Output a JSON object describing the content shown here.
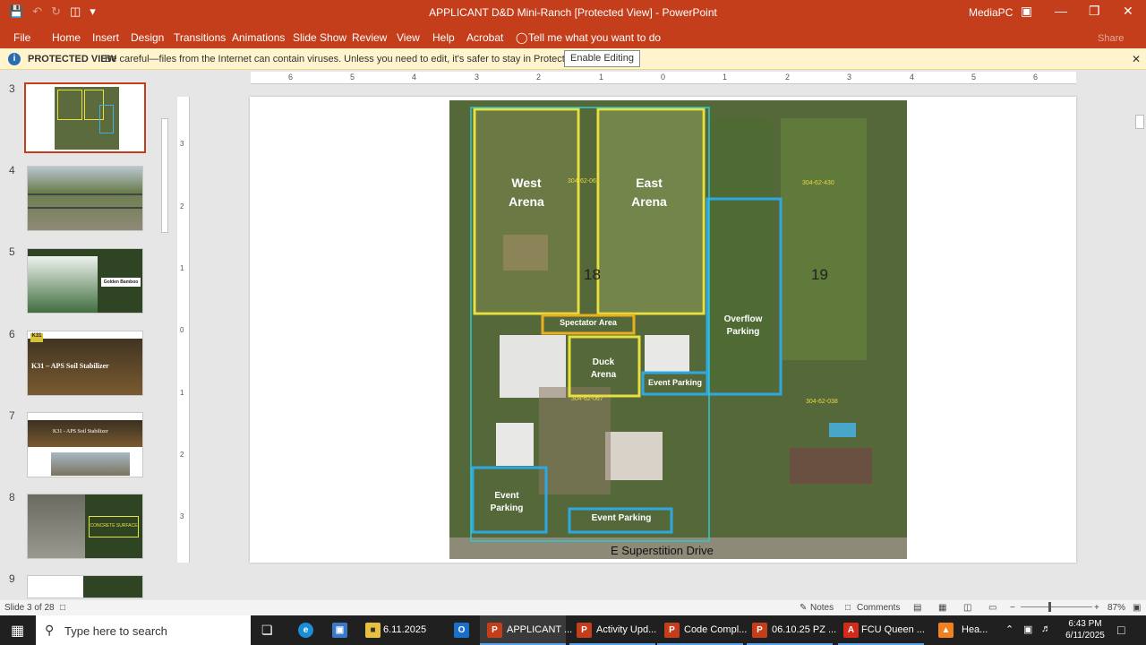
{
  "window": {
    "title": "APPLICANT D&D Mini-Ranch [Protected View]  -  PowerPoint",
    "user": "MediaPC"
  },
  "ribbon": {
    "tabs": [
      "File",
      "Home",
      "Insert",
      "Design",
      "Transitions",
      "Animations",
      "Slide Show",
      "Review",
      "View",
      "Help",
      "Acrobat"
    ],
    "tell_me": "Tell me what you want to do",
    "share": "Share"
  },
  "protected_view": {
    "label": "PROTECTED VIEW",
    "message": "Be careful—files from the Internet can contain viruses. Unless you need to edit, it's safer to stay in Protected View.",
    "button": "Enable Editing"
  },
  "thumbnails": {
    "numbers": [
      "3",
      "4",
      "5",
      "6",
      "7",
      "8",
      "9"
    ],
    "slide5_caption": "Golden Bamboo",
    "slide6_title": "K31 – APS Soil Stabilizer",
    "slide6_logo": "K31",
    "slide7_title": "K31 - APS Soil Stabilizer",
    "slide8_caption": "CONCRETE SURFACE"
  },
  "ruler": {
    "h": [
      "6",
      "5",
      "4",
      "3",
      "2",
      "1",
      "0",
      "1",
      "2",
      "3",
      "4",
      "5",
      "6"
    ],
    "v": [
      "3",
      "2",
      "1",
      "0",
      "1",
      "2",
      "3"
    ]
  },
  "slide": {
    "areas": {
      "west_arena": "West Arena",
      "east_arena": "East Arena",
      "spectator_area": "Spectator Area",
      "duck_arena": "Duck Arena",
      "overflow_parking": "Overflow Parking",
      "event_parking_1": "Event Parking",
      "event_parking_2": "Event Parking",
      "event_parking_3": "Event Parking"
    },
    "lot_18": "18",
    "lot_19": "19",
    "street": "E Superstition Drive",
    "parcels": [
      "304-62-067",
      "304-62-430",
      "304-62-067",
      "304-62-038"
    ]
  },
  "status": {
    "slide_info": "Slide 3 of 28",
    "notes": "Notes",
    "comments": "Comments",
    "zoom": "87%"
  },
  "taskbar": {
    "search_placeholder": "Type here to search",
    "apps": [
      "6.11.2025",
      "APPLICANT ...",
      "Activity Upd...",
      "Code Compl...",
      "06.10.25 PZ ...",
      "FCU Queen ...",
      "Hea..."
    ],
    "time": "6:43 PM",
    "date": "6/11/2025"
  }
}
